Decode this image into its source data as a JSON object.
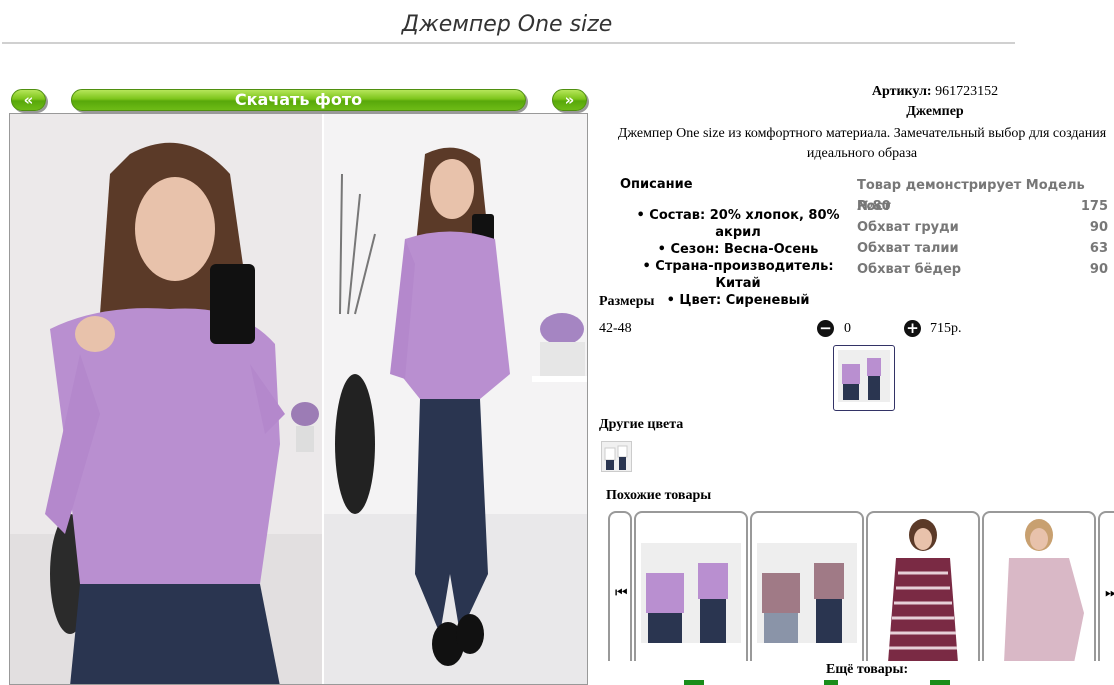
{
  "product": {
    "title": "Джемпер One size",
    "article_label": "Артикул:",
    "article_value": "961723152",
    "name": "Джемпер",
    "description": "Джемпер One size из комфортного материала. Замечательный выбор для создания идеального образа"
  },
  "gallery": {
    "prev_label": "«",
    "download_label": "Скачать фото",
    "next_label": "»"
  },
  "description_block": {
    "heading": "Описание",
    "items": [
      "Состав: 20% хлопок, 80% акрил",
      "Сезон: Весна-Осень",
      "Страна-производитель: Китай",
      "Цвет: Сиреневый"
    ]
  },
  "measurements": [
    {
      "label": "Товар демонстрирует Модель №80",
      "value": ""
    },
    {
      "label": "Рост",
      "value": "175"
    },
    {
      "label": "Обхват груди",
      "value": "90"
    },
    {
      "label": "Обхват талии",
      "value": "63"
    },
    {
      "label": "Обхват бёдер",
      "value": "90"
    }
  ],
  "sizes": {
    "heading": "Размеры",
    "size": "42-48",
    "minus_icon": "−",
    "quantity": "0",
    "plus_icon": "+",
    "price": "715р."
  },
  "other_colors": {
    "heading": "Другие цвета"
  },
  "similar": {
    "heading": "Похожие товары",
    "prev_icon": "⏮",
    "next_icon": "⏭",
    "more_label": "Ещё товары:"
  },
  "colors": {
    "accent_green": "#7cc41a",
    "sweater_lilac": "#b98fd0"
  }
}
